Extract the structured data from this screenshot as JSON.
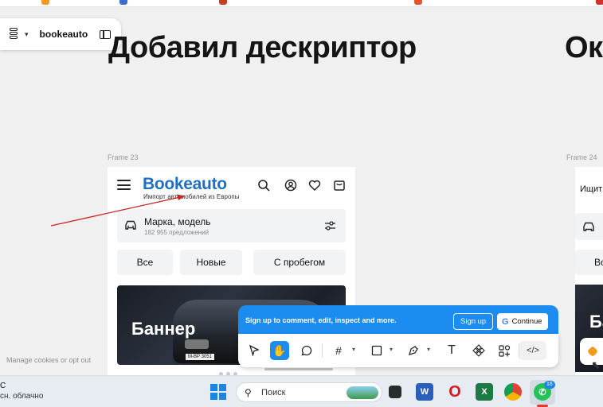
{
  "figma_bar": {
    "file_name": "bookeauto",
    "menu_icon": "figma-logo-icon",
    "panel_icon": "sidebar-panel-icon"
  },
  "canvas": {
    "heading_1": "Добавил дескриптор",
    "heading_2": "Ок",
    "frame_23_label": "Frame 23",
    "frame_24_label": "Frame 24",
    "cookies_link": "Manage cookies or opt out"
  },
  "frame23": {
    "brand": "Bookeauto",
    "tagline": "Импорт автомобилей из Европы",
    "search_title": "Марка, модель",
    "search_subtitle": "182 955 предложений",
    "chips": [
      "Все",
      "Новые",
      "С пробегом"
    ],
    "banner_text": "Баннер",
    "plate_text": "M-BP 3051",
    "brand_color": "#1f6fc4"
  },
  "frame24": {
    "header_text": "Ищит",
    "chip_text": "Во",
    "banner_text": "Ба"
  },
  "signup": {
    "message": "Sign up to comment, edit, inspect and more.",
    "signup_label": "Sign up",
    "continue_label": "Continue",
    "accent": "#1c8cf0"
  },
  "toolbar": {
    "dev_label": "</>"
  },
  "taskbar": {
    "weather_line1": "С",
    "weather_line2": "сн. облачно",
    "search_placeholder": "Поиск",
    "notification_count": "16"
  }
}
